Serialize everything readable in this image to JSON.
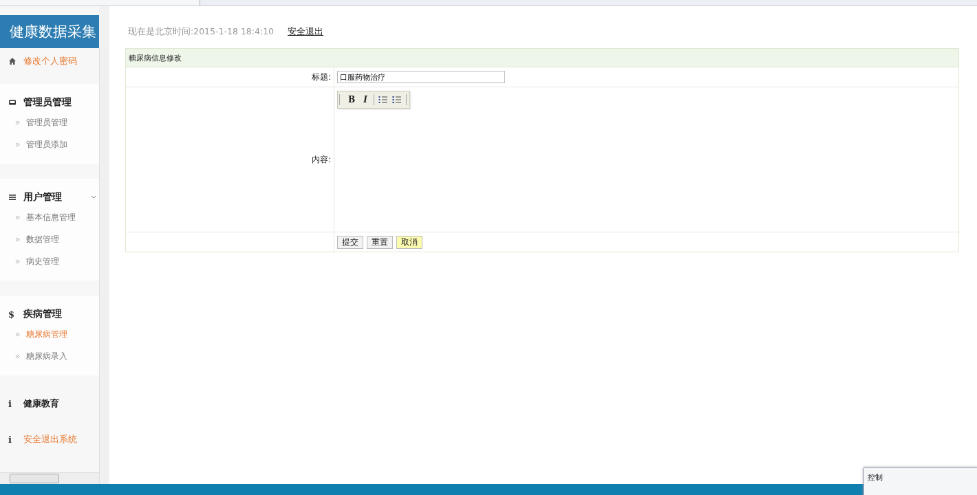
{
  "sidebar": {
    "brand": "健康数据采集",
    "groups": [
      {
        "label": "修改个人密码",
        "kind": "home",
        "highlighted": true
      },
      {
        "label": "管理员管理",
        "kind": "inbox",
        "highlighted": false,
        "items": [
          {
            "label": "管理员管理",
            "selected": false
          },
          {
            "label": "管理员添加",
            "selected": false
          }
        ]
      },
      {
        "label": "用户管理",
        "kind": "list",
        "highlighted": false,
        "toggle": true,
        "items": [
          {
            "label": "基本信息管理",
            "selected": false
          },
          {
            "label": "数据管理",
            "selected": false
          },
          {
            "label": "病史管理",
            "selected": false
          }
        ]
      },
      {
        "label": "疾病管理",
        "kind": "glyph",
        "glyph": "$",
        "highlighted": false,
        "items": [
          {
            "label": "糖尿病管理",
            "selected": true
          },
          {
            "label": "糖尿病录入",
            "selected": false
          }
        ]
      },
      {
        "label": "健康教育",
        "kind": "glyph",
        "glyph": "i",
        "highlighted": false
      },
      {
        "label": "安全退出系统",
        "kind": "glyph",
        "glyph": "i",
        "highlighted": true
      }
    ]
  },
  "header": {
    "clock": "现在是北京时间:2015-1-18 18:4:10",
    "logout": "安全退出"
  },
  "form": {
    "title": "糖尿病信息修改",
    "title_label": "标题:",
    "title_value": "口服药物治疗",
    "content_label": "内容:",
    "toolbar": [
      "B",
      "I"
    ],
    "buttons": [
      {
        "label": "提交",
        "highlighted": false
      },
      {
        "label": "重置",
        "highlighted": false
      },
      {
        "label": "取消",
        "highlighted": true
      }
    ]
  },
  "popup": {
    "title": "控制"
  }
}
